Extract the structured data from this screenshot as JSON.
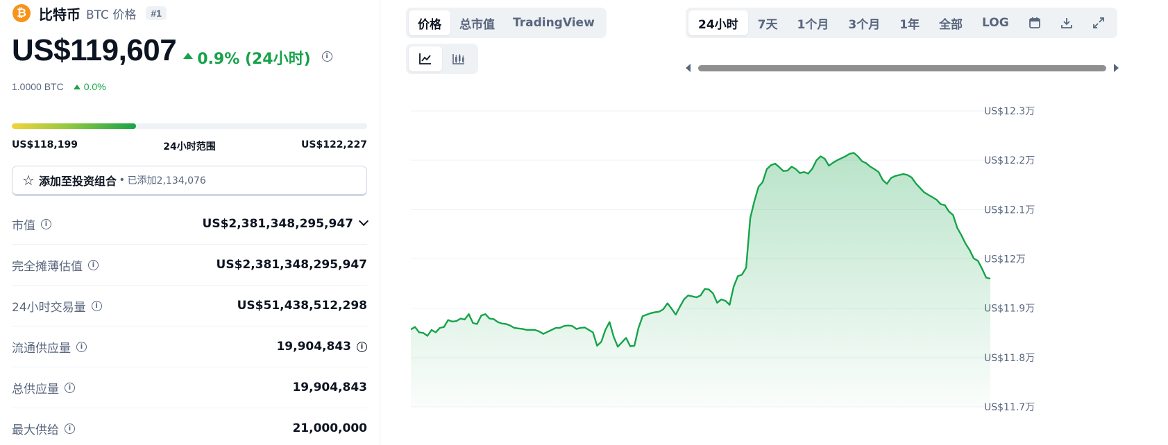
{
  "coin": {
    "logo_glyph": "₿",
    "name": "比特币",
    "symbol_label": "BTC 价格",
    "rank": "#1",
    "price": "US$119,607",
    "change": "0.9% (24小时)",
    "btc_value": "1.0000 BTC",
    "btc_change": "0.0%"
  },
  "range": {
    "low": "US$118,199",
    "label": "24小时范围",
    "high": "US$122,227",
    "position_fraction": 0.35
  },
  "portfolio": {
    "label": "添加至投资组合",
    "dot": "•",
    "count": "已添加2,134,076"
  },
  "stats": [
    {
      "label": "市值",
      "value": "US$2,381,348,295,947"
    },
    {
      "label": "完全摊薄估值",
      "value": "US$2,381,348,295,947"
    },
    {
      "label": "24小时交易量",
      "value": "US$51,438,512,298"
    },
    {
      "label": "流通供应量",
      "value": "19,904,843"
    },
    {
      "label": "总供应量",
      "value": "19,904,843"
    },
    {
      "label": "最大供给",
      "value": "21,000,000"
    }
  ],
  "view_tabs": [
    "价格",
    "总市值",
    "TradingView"
  ],
  "time_tabs": [
    "24小时",
    "7天",
    "1个月",
    "3个月",
    "1年",
    "全部",
    "LOG"
  ],
  "icons": {
    "line_chart": "line-chart-icon",
    "candle_chart": "candlestick-icon",
    "calendar": "calendar-icon",
    "download": "download-icon",
    "fullscreen": "fullscreen-icon"
  },
  "colors": {
    "accent_green": "#16a34a",
    "btc_orange": "#f7931a",
    "line": "#16a34a"
  },
  "chart_data": {
    "type": "area",
    "ylim": [
      117000,
      123000
    ],
    "y_ticks": [
      117000,
      118000,
      119000,
      120000,
      121000,
      122000,
      123000
    ],
    "y_tick_labels": [
      "US$11.7万",
      "US$11.8万",
      "US$11.9万",
      "US$12万",
      "US$12.1万",
      "US$12.2万",
      "US$12.3万"
    ],
    "grid": true,
    "values": [
      118570,
      118620,
      118510,
      118500,
      118440,
      118560,
      118510,
      118600,
      118620,
      118760,
      118730,
      118740,
      118790,
      118770,
      118880,
      118700,
      118680,
      118850,
      118880,
      118790,
      118780,
      118720,
      118690,
      118680,
      118650,
      118600,
      118590,
      118580,
      118560,
      118560,
      118560,
      118530,
      118480,
      118520,
      118560,
      118600,
      118600,
      118640,
      118650,
      118640,
      118580,
      118600,
      118610,
      118560,
      118510,
      118240,
      118320,
      118560,
      118720,
      118420,
      118220,
      118310,
      118400,
      118230,
      118240,
      118600,
      118840,
      118870,
      118900,
      118920,
      118930,
      118980,
      119100,
      118990,
      118870,
      119030,
      119180,
      119260,
      119240,
      119220,
      119260,
      119390,
      119380,
      119300,
      119110,
      119180,
      119150,
      119070,
      119440,
      119650,
      119680,
      119820,
      120830,
      121170,
      121460,
      121560,
      121820,
      121900,
      121930,
      121860,
      121780,
      121790,
      121870,
      121820,
      121740,
      121760,
      121730,
      121830,
      122000,
      122080,
      122030,
      121890,
      121950,
      122000,
      122040,
      122080,
      122130,
      122150,
      122080,
      121980,
      121940,
      121870,
      121820,
      121760,
      121600,
      121520,
      121640,
      121680,
      121700,
      121720,
      121700,
      121650,
      121530,
      121440,
      121350,
      121300,
      121250,
      121200,
      121110,
      121090,
      120960,
      120890,
      120630,
      120480,
      120310,
      120180,
      120010,
      119960,
      119800,
      119620,
      119600
    ]
  }
}
